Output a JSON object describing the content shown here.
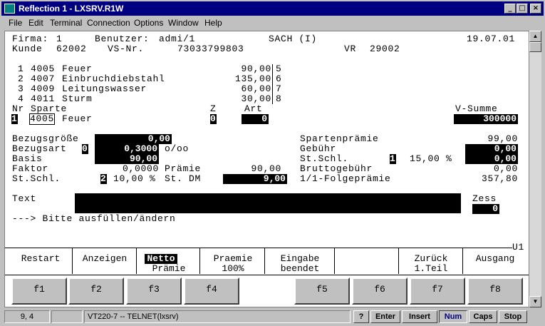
{
  "window": {
    "title": "Reflection 1 - LXSRV.R1W"
  },
  "menu": [
    "File",
    "Edit",
    "Terminal",
    "Connection",
    "Options",
    "Window",
    "Help"
  ],
  "header": {
    "firma_label": "Firma:",
    "firma": "1",
    "benutzer_label": "Benutzer:",
    "benutzer": "admi/1",
    "sach": "SACH (I)",
    "date": "19.07.01",
    "kunde_label": "Kunde",
    "kunde": "62002",
    "vsnr_label": "VS-Nr.",
    "vsnr": "73033799803",
    "vr_label": "VR",
    "vr": "29002"
  },
  "sparten_list": [
    {
      "pos": "1",
      "code": "4005",
      "name": "Feuer",
      "value": "90,00",
      "ref": "5"
    },
    {
      "pos": "2",
      "code": "4007",
      "name": "Einbruchdiebstahl",
      "value": "135,00",
      "ref": "6"
    },
    {
      "pos": "3",
      "code": "4009",
      "name": "Leitungswasser",
      "value": "60,00",
      "ref": "7"
    },
    {
      "pos": "4",
      "code": "4011",
      "name": "Sturm",
      "value": "30,00",
      "ref": "8"
    }
  ],
  "entry": {
    "nr_label": "Nr",
    "sparte_label": "Sparte",
    "z_label": "Z",
    "art_label": "Art",
    "vsumme_label": "V-Summe",
    "nr": "1",
    "sparte": "4005",
    "sparte_name": "Feuer",
    "z": "0",
    "art": "0",
    "vsumme": "300000"
  },
  "fields": {
    "bezugsgroesse_label": "Bezugsgröße",
    "bezugsgroesse": "0,00",
    "bezugsart_label": "Bezugsart",
    "bezugsart_code": "0",
    "bezugsart": "0,3000",
    "bezugsart_unit": "o/oo",
    "basis_label": "Basis",
    "basis": "90,00",
    "faktor_label": "Faktor",
    "faktor": "0,0000",
    "praemie_label": "Prämie",
    "praemie": "90,00",
    "stschl_label": "St.Schl.",
    "stschl_code": "2",
    "stschl_pct": "10,00 %",
    "stdm_label": "St. DM",
    "stdm": "9,00",
    "spartenpraemie_label": "Spartenprämie",
    "spartenpraemie": "99,00",
    "gebuehr_label": "Gebühr",
    "gebuehr": "0,00",
    "stschl2_label": "St.Schl.",
    "stschl2_code": "1",
    "stschl2_pct": "15,00 %",
    "stschl2": "0,00",
    "bruttogebuehr_label": "Bruttogebühr",
    "bruttogebuehr": "0,00",
    "folgepraemie_label": "1/1-Folgeprämie",
    "folgepraemie": "357,80",
    "text_label": "Text",
    "text": "",
    "zess_label": "Zess",
    "zess": "0",
    "message": "---> Bitte ausfüllen/ändern"
  },
  "page_id": "U1",
  "function_labels": [
    {
      "line1": "Restart",
      "line2": ""
    },
    {
      "line1": "Anzeigen",
      "line2": ""
    },
    {
      "line1": "Netto",
      "line2": "Prämie"
    },
    {
      "line1": "Praemie",
      "line2": "100%"
    },
    {
      "line1": "Eingabe",
      "line2": "beendet"
    },
    {
      "line1": "",
      "line2": ""
    },
    {
      "line1": "Zurück",
      "line2": "1.Teil"
    },
    {
      "line1": "Ausgang",
      "line2": ""
    }
  ],
  "function_keys": [
    "f1",
    "f2",
    "f3",
    "f4",
    "f5",
    "f6",
    "f7",
    "f8"
  ],
  "status": {
    "cursor": "9, 4",
    "session": "VT220-7 -- TELNET(lxsrv)",
    "help": "?",
    "enter": "Enter",
    "insert": "Insert",
    "num": "Num",
    "caps": "Caps",
    "stop": "Stop"
  }
}
